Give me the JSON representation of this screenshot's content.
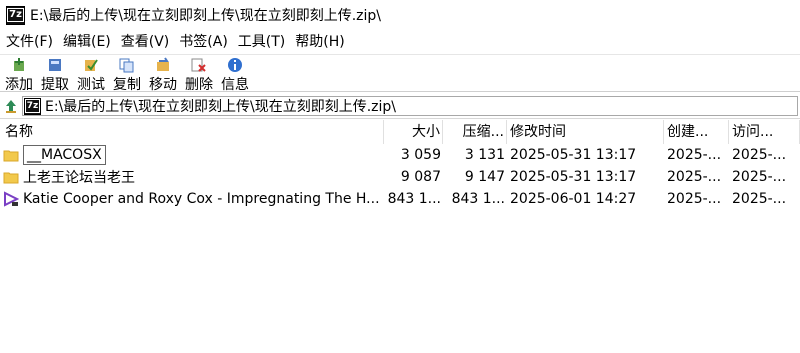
{
  "window": {
    "title": "E:\\最后的上传\\现在立刻即刻上传\\现在立刻即刻上传.zip\\",
    "app_icon_text": "7z"
  },
  "menu": [
    "文件(F)",
    "编辑(E)",
    "查看(V)",
    "书签(A)",
    "工具(T)",
    "帮助(H)"
  ],
  "toolbar": [
    {
      "label": "添加",
      "icon": "add-icon"
    },
    {
      "label": "提取",
      "icon": "extract-icon"
    },
    {
      "label": "测试",
      "icon": "test-icon"
    },
    {
      "label": "复制",
      "icon": "copy-icon"
    },
    {
      "label": "移动",
      "icon": "move-icon"
    },
    {
      "label": "删除",
      "icon": "delete-icon"
    },
    {
      "label": "信息",
      "icon": "info-icon"
    }
  ],
  "address": {
    "path": "E:\\最后的上传\\现在立刻即刻上传\\现在立刻即刻上传.zip\\"
  },
  "columns": {
    "name": "名称",
    "size": "大小",
    "packed": "压缩...",
    "modified": "修改时间",
    "created": "创建...",
    "accessed": "访问..."
  },
  "rows": [
    {
      "name": "__MACOSX",
      "size": "3 059",
      "packed": "3 131",
      "modified": "2025-05-31 13:17",
      "created": "2025-...",
      "accessed": "2025-...",
      "type": "folder"
    },
    {
      "name": "上老王论坛当老王",
      "size": "9 087",
      "packed": "9 147",
      "modified": "2025-05-31 13:17",
      "created": "2025-...",
      "accessed": "2025-...",
      "type": "folder"
    },
    {
      "name": "Katie Cooper and Roxy Cox - Impregnating The H...",
      "size": "843 1...",
      "packed": "843 1...",
      "modified": "2025-06-01 14:27",
      "created": "2025-...",
      "accessed": "2025-...",
      "type": "video"
    }
  ],
  "colors": {
    "folder": "#f2c94c",
    "video": "#7a3fc4",
    "selection_border": "#666666"
  }
}
